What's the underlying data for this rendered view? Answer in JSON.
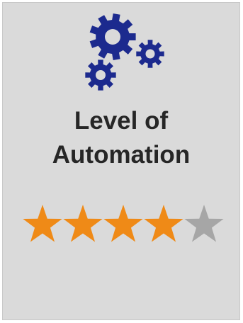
{
  "title_line1": "Level of",
  "title_line2": "Automation",
  "icon": "gears-icon",
  "rating": {
    "value": 4,
    "max": 5
  },
  "colors": {
    "background": "#dadada",
    "gear": "#1c2a8e",
    "title": "#262626",
    "star_filled": "#ef8a17",
    "star_empty": "#a6a6a6"
  }
}
